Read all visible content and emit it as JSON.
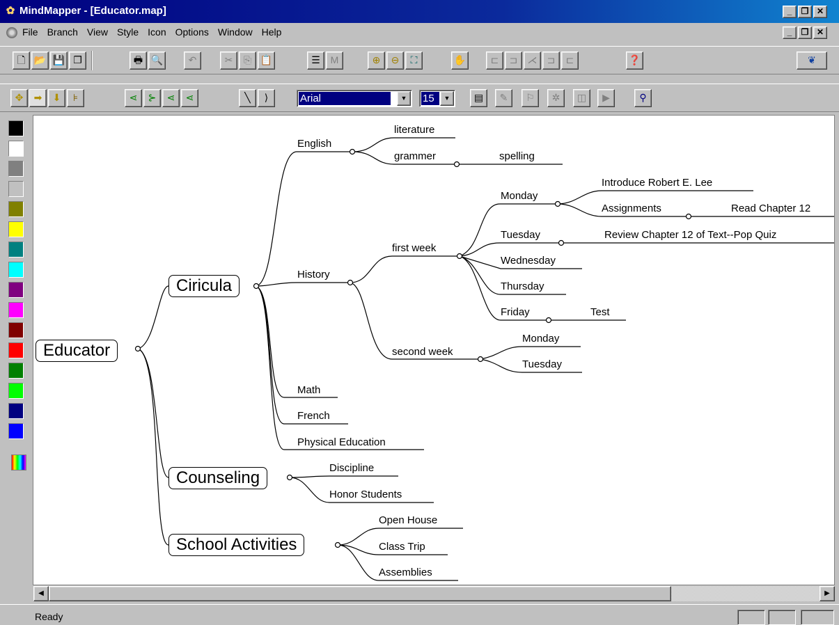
{
  "window": {
    "title": "MindMapper - [Educator.map]"
  },
  "menu": [
    "File",
    "Branch",
    "View",
    "Style",
    "Icon",
    "Options",
    "Window",
    "Help"
  ],
  "toolbar2": {
    "font": "Arial",
    "size": "15"
  },
  "palette": [
    "#000000",
    "#ffffff",
    "#808080",
    "#c0c0c0",
    "#808000",
    "#ffff00",
    "#008080",
    "#00ffff",
    "#800080",
    "#ff00ff",
    "#800000",
    "#ff0000",
    "#008000",
    "#00ff00",
    "#000080",
    "#0000ff"
  ],
  "map": {
    "root": "Educator",
    "nodes": {
      "ciricula": "Ciricula",
      "counseling": "Counseling",
      "activities": "School Activities"
    },
    "labels": {
      "english": "English",
      "literature": "literature",
      "grammer": "grammer",
      "spelling": "spelling",
      "history": "History",
      "first_week": "first week",
      "monday1": "Monday",
      "introduce": "Introduce Robert E. Lee",
      "assignments": "Assignments",
      "read_ch": "Read Chapter 12",
      "tuesday1": "Tuesday",
      "review": "Review Chapter 12 of Text--Pop Quiz",
      "wednesday": "Wednesday",
      "thursday": "Thursday",
      "friday": "Friday",
      "test": "Test",
      "second_week": "second week",
      "monday2": "Monday",
      "tuesday2": "Tuesday",
      "math": "Math",
      "french": "French",
      "pe": "Physical Education",
      "discipline": "Discipline",
      "honor": "Honor Students",
      "open_house": "Open House",
      "class_trip": "Class Trip",
      "assemblies": "Assemblies"
    }
  },
  "status": {
    "text": "Ready"
  }
}
